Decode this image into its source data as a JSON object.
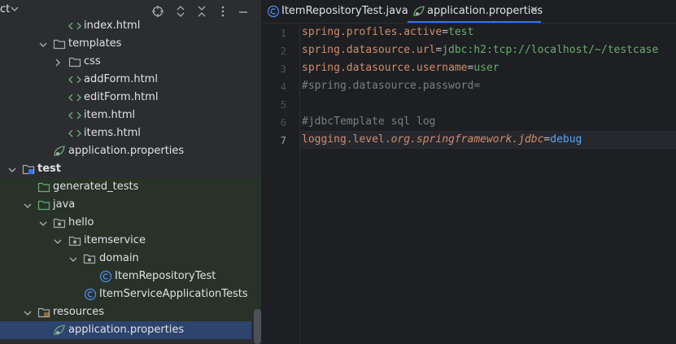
{
  "project": {
    "title": "ct",
    "tree": [
      {
        "label": "index.html"
      },
      {
        "label": "templates"
      },
      {
        "label": "css"
      },
      {
        "label": "addForm.html"
      },
      {
        "label": "editForm.html"
      },
      {
        "label": "item.html"
      },
      {
        "label": "items.html"
      },
      {
        "label": "application.properties"
      },
      {
        "label": "test"
      },
      {
        "label": "generated_tests"
      },
      {
        "label": "java"
      },
      {
        "label": "hello"
      },
      {
        "label": "itemservice"
      },
      {
        "label": "domain"
      },
      {
        "label": "ItemRepositoryTest"
      },
      {
        "label": "ItemServiceApplicationTests"
      },
      {
        "label": "resources"
      },
      {
        "label": "application.properties"
      }
    ]
  },
  "editor": {
    "tabs": [
      {
        "label": "ItemRepositoryTest.java",
        "active": false
      },
      {
        "label": "application.properties",
        "active": true
      }
    ],
    "close_glyph": "×",
    "line_numbers": [
      "1",
      "2",
      "3",
      "4",
      "5",
      "6",
      "7"
    ],
    "code": {
      "l1_key": "spring.profiles.active",
      "l1_eq": "=",
      "l1_val": "test",
      "l2_key": "spring.datasource.url",
      "l2_eq": "=",
      "l2_val": "jdbc:h2:tcp://localhost/~/testcase",
      "l3_key": "spring.datasource.username",
      "l3_eq": "=",
      "l3_val": "user",
      "l4_comment": "#spring.datasource.password=",
      "l6_comment": "#jdbcTemplate sql log",
      "l7_key_a": "logging.level.",
      "l7_key_b": "org.springframework.jdbc",
      "l7_eq": "=",
      "l7_val": "debug"
    }
  },
  "colors": {
    "accent": "#3574f0",
    "selection": "#2e436e",
    "test_bg": "#283228"
  }
}
